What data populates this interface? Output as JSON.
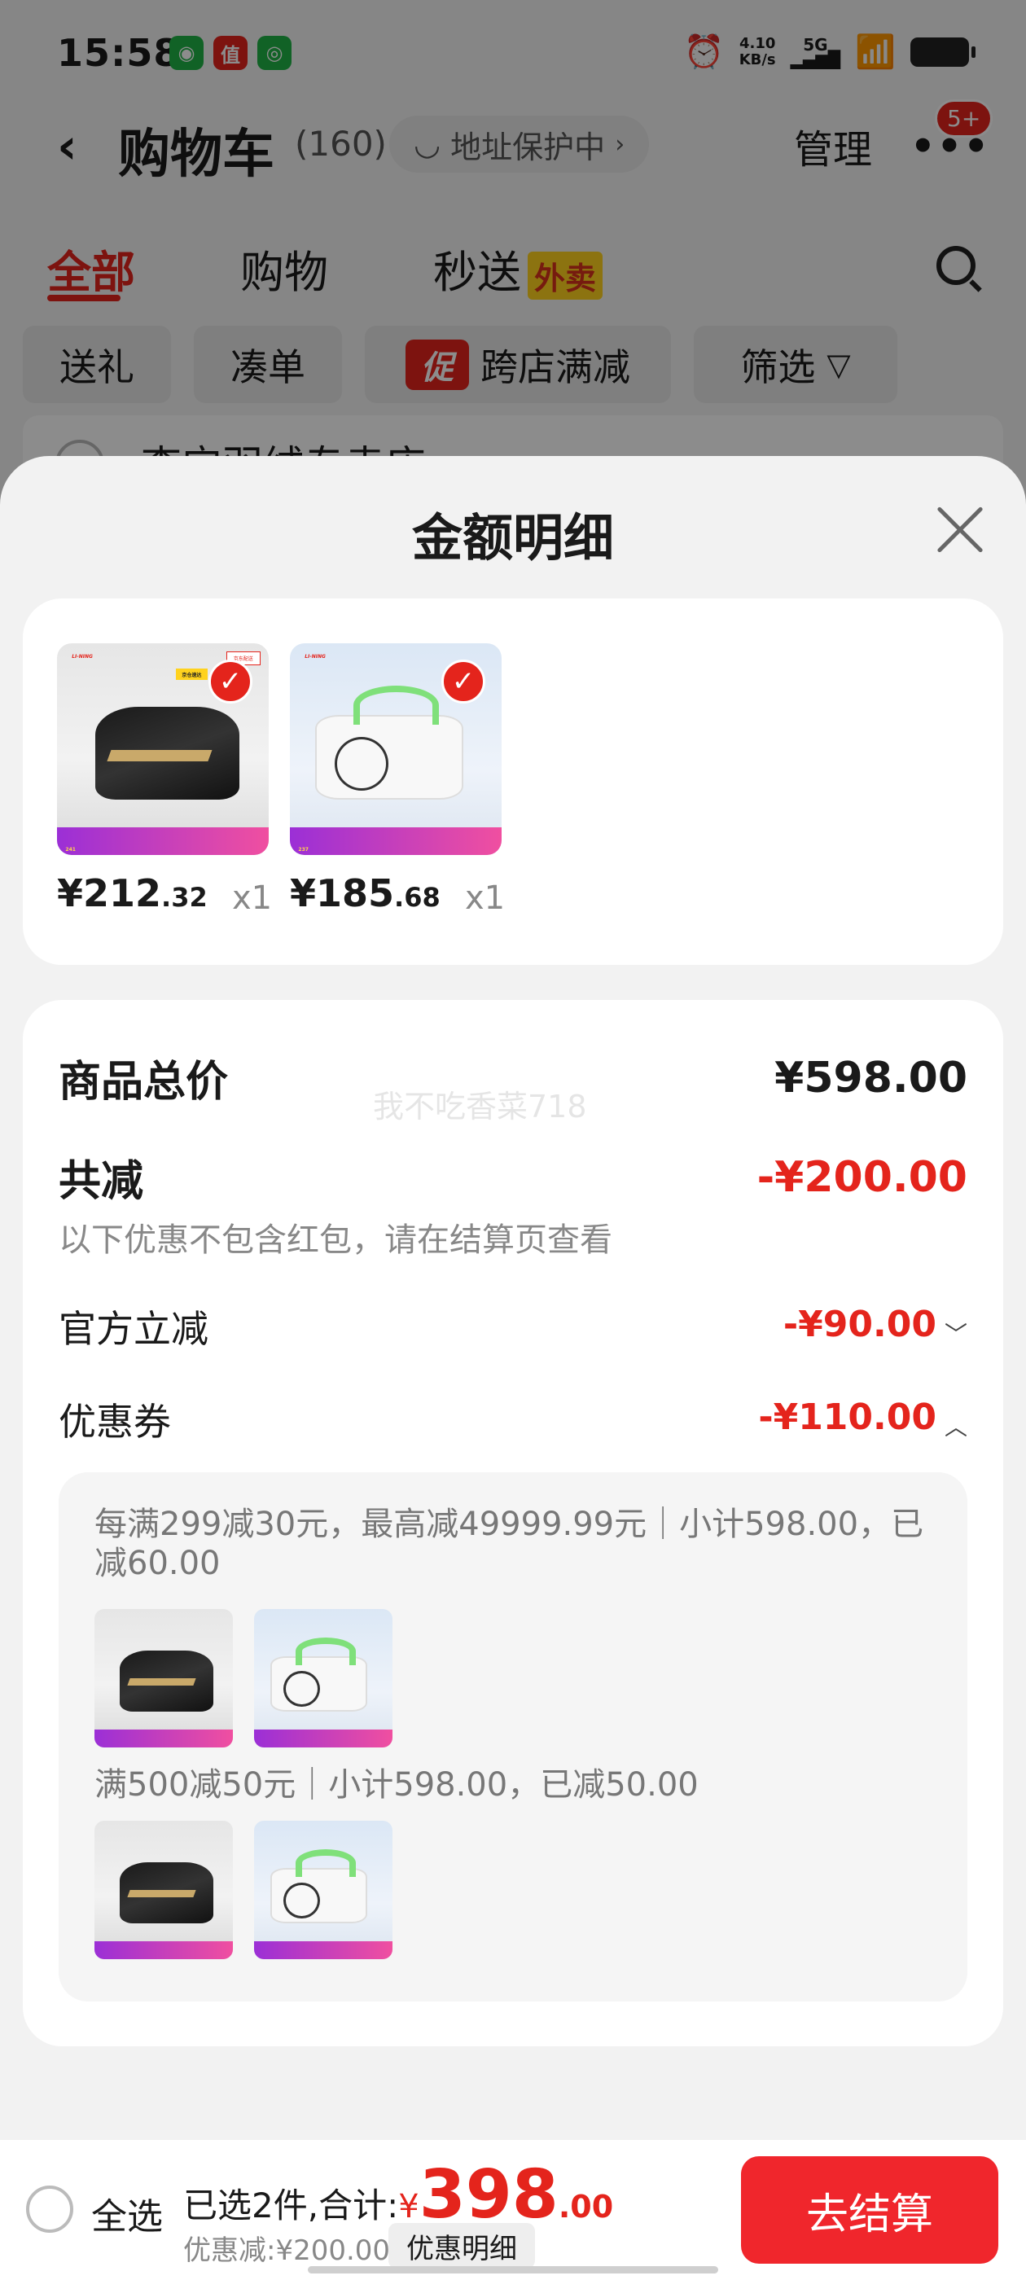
{
  "status_bar": {
    "time": "15:58",
    "apps": [
      "chat-app-icon",
      "zhi-app-icon",
      "wechat-icon"
    ],
    "net_speed_value": "4.10",
    "net_speed_unit": "KB/s",
    "network": "5G"
  },
  "nav": {
    "title": "购物车",
    "count": "(160)",
    "address_protect": "地址保护中",
    "manage": "管理",
    "badge": "5+"
  },
  "tabs": [
    {
      "label": "全部",
      "active": true
    },
    {
      "label": "购物",
      "active": false
    },
    {
      "label": "秒送",
      "badge": "外卖",
      "active": false
    }
  ],
  "chips": [
    {
      "label": "送礼"
    },
    {
      "label": "凑单"
    },
    {
      "tag": "促",
      "label": "跨店满减"
    },
    {
      "label": "筛选"
    }
  ],
  "shop_peek": "李宁羽绒专卖店",
  "sheet": {
    "title": "金额明细",
    "products": [
      {
        "price_int": "¥212",
        "price_dec": ".32",
        "qty": "x1",
        "image": "black-racket-bag",
        "strip_num": "241",
        "logo": "LI-NING"
      },
      {
        "price_int": "¥185",
        "price_dec": ".68",
        "qty": "x1",
        "image": "white-multi-bag",
        "strip_num": "237",
        "logo": "LI-NING"
      }
    ],
    "details": {
      "total_label": "商品总价",
      "total_value": "¥598.00",
      "watermark": "我不吃香菜718",
      "reduce_label": "共减",
      "reduce_value": "-¥200.00",
      "reduce_note": "以下优惠不包含红包，请在结算页查看",
      "official_label": "官方立减",
      "official_value": "-¥90.00",
      "coupon_label": "优惠券",
      "coupon_value": "-¥110.00",
      "coupon_rule_1": "每满299减30元，最高减49999.99元｜小计598.00，已减60.00",
      "coupon_rule_2": "满500减50元｜小计598.00，已减50.00"
    }
  },
  "bottom": {
    "select_all": "全选",
    "selected_prefix": "已选2件,合计:",
    "currency": "¥",
    "total_int": "398",
    "total_dec": ".00",
    "discount": "优惠减:¥200.00",
    "detail_button": "优惠明细",
    "checkout": "去结算"
  },
  "colors": {
    "accent_red": "#e4241c",
    "checkout_red": "#f0262c",
    "badge_yellow": "#ffd21e"
  }
}
